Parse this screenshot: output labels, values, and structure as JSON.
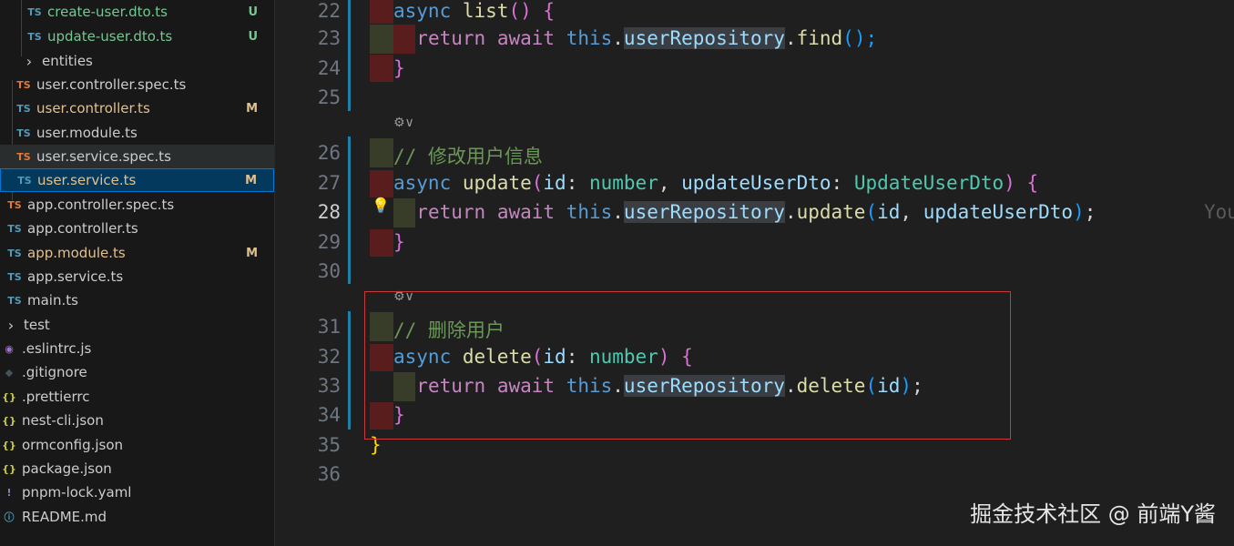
{
  "explorer": {
    "items": [
      {
        "name": "create-user.dto.ts",
        "icon": "TS",
        "icon_color": "#519aba",
        "badge": "U",
        "name_color": "#73c991",
        "badge_color": "#73c991"
      },
      {
        "name": "update-user.dto.ts",
        "icon": "TS",
        "icon_color": "#519aba",
        "badge": "U",
        "name_color": "#73c991",
        "badge_color": "#73c991"
      },
      {
        "name": "entities",
        "icon": "›",
        "icon_color": "#cccccc",
        "badge": "",
        "name_color": "#cccccc"
      },
      {
        "name": "user.controller.spec.ts",
        "icon": "TS",
        "icon_color": "#e37933",
        "badge": "",
        "name_color": "#cccccc"
      },
      {
        "name": "user.controller.ts",
        "icon": "TS",
        "icon_color": "#519aba",
        "badge": "M",
        "name_color": "#e2c08d",
        "badge_color": "#e2c08d"
      },
      {
        "name": "user.module.ts",
        "icon": "TS",
        "icon_color": "#519aba",
        "badge": "",
        "name_color": "#cccccc"
      },
      {
        "name": "user.service.spec.ts",
        "icon": "TS",
        "icon_color": "#e37933",
        "badge": "",
        "name_color": "#cccccc"
      },
      {
        "name": "user.service.ts",
        "icon": "TS",
        "icon_color": "#519aba",
        "badge": "M",
        "name_color": "#e2c08d",
        "badge_color": "#e2c08d"
      },
      {
        "name": "app.controller.spec.ts",
        "icon": "TS",
        "icon_color": "#e37933",
        "badge": "",
        "name_color": "#cccccc"
      },
      {
        "name": "app.controller.ts",
        "icon": "TS",
        "icon_color": "#519aba",
        "badge": "",
        "name_color": "#cccccc"
      },
      {
        "name": "app.module.ts",
        "icon": "TS",
        "icon_color": "#519aba",
        "badge": "M",
        "name_color": "#e2c08d",
        "badge_color": "#e2c08d"
      },
      {
        "name": "app.service.ts",
        "icon": "TS",
        "icon_color": "#519aba",
        "badge": "",
        "name_color": "#cccccc"
      },
      {
        "name": "main.ts",
        "icon": "TS",
        "icon_color": "#519aba",
        "badge": "",
        "name_color": "#cccccc"
      },
      {
        "name": "test",
        "icon": "›",
        "icon_color": "#cccccc",
        "badge": "",
        "name_color": "#cccccc"
      },
      {
        "name": ".eslintrc.js",
        "icon": "◉",
        "icon_color": "#a074c4",
        "badge": "",
        "name_color": "#cccccc"
      },
      {
        "name": ".gitignore",
        "icon": "◆",
        "icon_color": "#41535b",
        "badge": "",
        "name_color": "#cccccc"
      },
      {
        "name": ".prettierrc",
        "icon": "{}",
        "icon_color": "#cbcb41",
        "badge": "",
        "name_color": "#cccccc"
      },
      {
        "name": "nest-cli.json",
        "icon": "{}",
        "icon_color": "#cbcb41",
        "badge": "",
        "name_color": "#cccccc"
      },
      {
        "name": "ormconfig.json",
        "icon": "{}",
        "icon_color": "#cbcb41",
        "badge": "",
        "name_color": "#cccccc"
      },
      {
        "name": "package.json",
        "icon": "{}",
        "icon_color": "#cbcb41",
        "badge": "",
        "name_color": "#cccccc"
      },
      {
        "name": "pnpm-lock.yaml",
        "icon": "!",
        "icon_color": "#a074c4",
        "badge": "",
        "name_color": "#cccccc"
      },
      {
        "name": "README.md",
        "icon": "ⓘ",
        "icon_color": "#519aba",
        "badge": "",
        "name_color": "#cccccc"
      }
    ]
  },
  "editor": {
    "line_numbers": [
      "22",
      "23",
      "24",
      "25",
      "26",
      "27",
      "28",
      "29",
      "30",
      "31",
      "32",
      "33",
      "34",
      "35",
      "36"
    ],
    "active_line": "28",
    "code": {
      "l22": {
        "kw": "async",
        "fn": "list",
        "rest": "() {"
      },
      "l23": {
        "ret": "return",
        "await": "await",
        "this": "this",
        "repo": "userRepository",
        "method": "find",
        "tail": "();"
      },
      "l24": "}",
      "l26": "// 修改用户信息",
      "l27": {
        "kw": "async",
        "fn": "update",
        "p1": "id",
        "t1": "number",
        "p2": "updateUserDto",
        "t2": "UpdateUserDto"
      },
      "l28": {
        "ret": "return",
        "await": "await",
        "this": "this",
        "repo": "userRepository",
        "method": "update",
        "a1": "id",
        "a2": "updateUserDto"
      },
      "l29": "}",
      "l31": "// 删除用户",
      "l32": {
        "kw": "async",
        "fn": "delete",
        "p1": "id",
        "t1": "number"
      },
      "l33": {
        "ret": "return",
        "await": "await",
        "this": "this",
        "repo": "userRepository",
        "method": "delete",
        "a1": "id"
      },
      "l34": "}",
      "l35": "}"
    },
    "inline_blame": "You",
    "codelens_icon": "⚙∨"
  },
  "watermark": "掘金技术社区 @ 前端Y酱"
}
